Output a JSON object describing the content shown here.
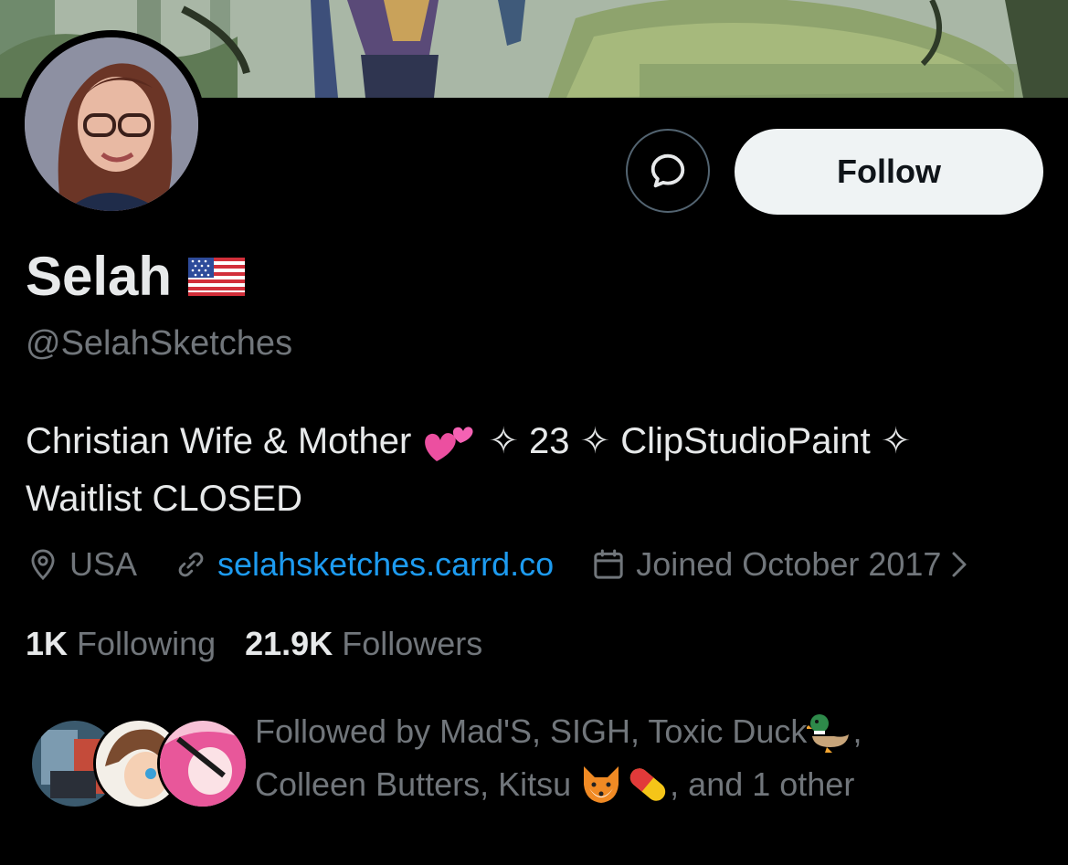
{
  "profile": {
    "name": "Selah",
    "handle": "@SelahSketches",
    "bio_line1_a": "Christian Wife & Mother",
    "bio_line1_b": "✧ 23 ✧ ClipStudioPaint ✧",
    "bio_line2": "Waitlist CLOSED",
    "location": "USA",
    "website": "selahsketches.carrd.co",
    "joined": "Joined October 2017"
  },
  "actions": {
    "follow_label": "Follow"
  },
  "stats": {
    "following_count": "1K",
    "following_label": "Following",
    "followers_count": "21.9K",
    "followers_label": "Followers"
  },
  "followed_by": {
    "line1": "Followed by Mad'S, SIGH, Toxic Duck",
    "line1_end": ",",
    "line2": "Colleen Butters, Kitsu",
    "line2_end": ", and 1 other"
  },
  "icons": {
    "message": "message-icon",
    "location": "location-pin-icon",
    "link": "link-icon",
    "calendar": "calendar-icon",
    "chevron": "chevron-right-icon",
    "flag": "us-flag-icon",
    "hearts": "two-hearts-icon",
    "duck": "duck-icon",
    "fox": "fox-icon",
    "pill": "pill-icon"
  },
  "colors": {
    "background": "#000000",
    "link": "#1d9bf0",
    "secondary_text": "#71767b",
    "follow_button": "#eff3f4"
  }
}
